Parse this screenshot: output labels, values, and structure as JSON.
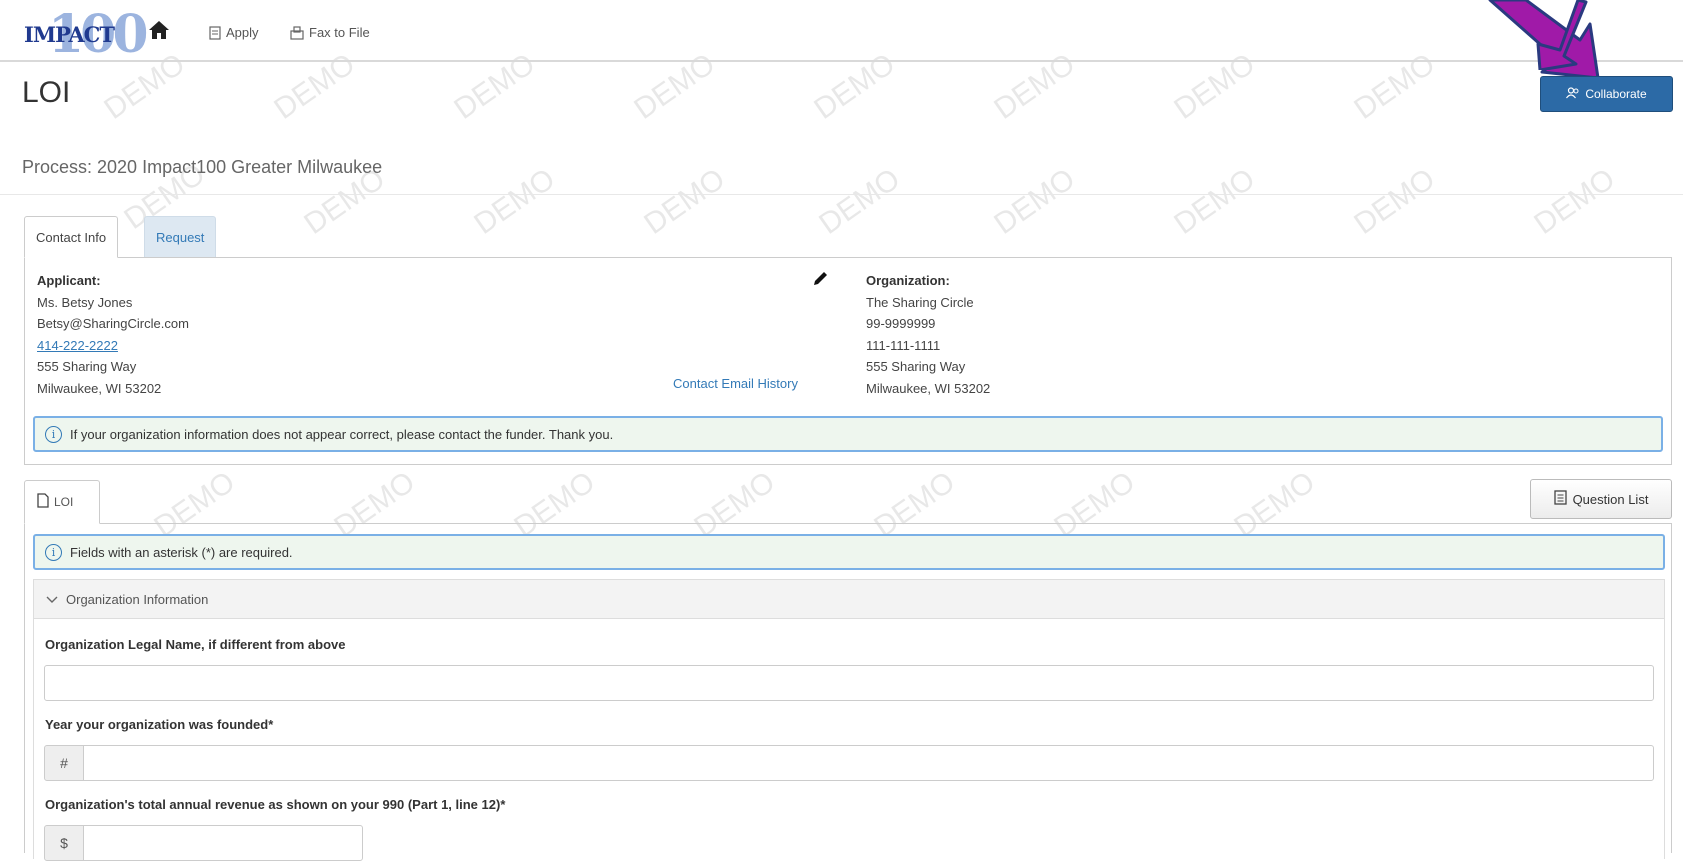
{
  "nav": {
    "logo_text": "IMPACT",
    "logo_number": "100",
    "apply_label": "Apply",
    "fax_label": "Fax to File"
  },
  "header": {
    "page_title": "LOI",
    "collaborate_label": "Collaborate",
    "process_text": "Process: 2020 Impact100 Greater Milwaukee"
  },
  "contact_tabs": [
    "Contact Info",
    "Request"
  ],
  "applicant": {
    "heading": "Applicant:",
    "name": "Ms. Betsy Jones",
    "email": "Betsy@SharingCircle.com",
    "phone": "414-222-2222",
    "street": "555 Sharing Way",
    "city": "Milwaukee, WI 53202"
  },
  "contact_email_history": "Contact Email History",
  "organization": {
    "heading": "Organization:",
    "name": "The Sharing Circle",
    "ein": "99-9999999",
    "phone": "111-111-1111",
    "street": "555 Sharing Way",
    "city": "Milwaukee, WI 53202"
  },
  "org_alert": "If your organization information does not appear correct, please contact the funder. Thank you.",
  "loi_tab": "LOI",
  "question_list_label": "Question List",
  "required_alert": "Fields with an asterisk (*) are required.",
  "section": {
    "title": "Organization Information",
    "questions": [
      {
        "label": "Organization Legal Name, if different from above",
        "value": ""
      },
      {
        "label": "Year your organization was founded*",
        "addon": "#",
        "value": ""
      },
      {
        "label": "Organization's total annual revenue as shown on your 990 (Part 1, line 12)*",
        "addon": "$",
        "value": ""
      }
    ]
  },
  "watermark": "DEMO",
  "colors": {
    "primary": "#2c6aa6",
    "link": "#337ab7",
    "arrow": "#a01aa8",
    "alert_bg": "#eef6ee"
  }
}
